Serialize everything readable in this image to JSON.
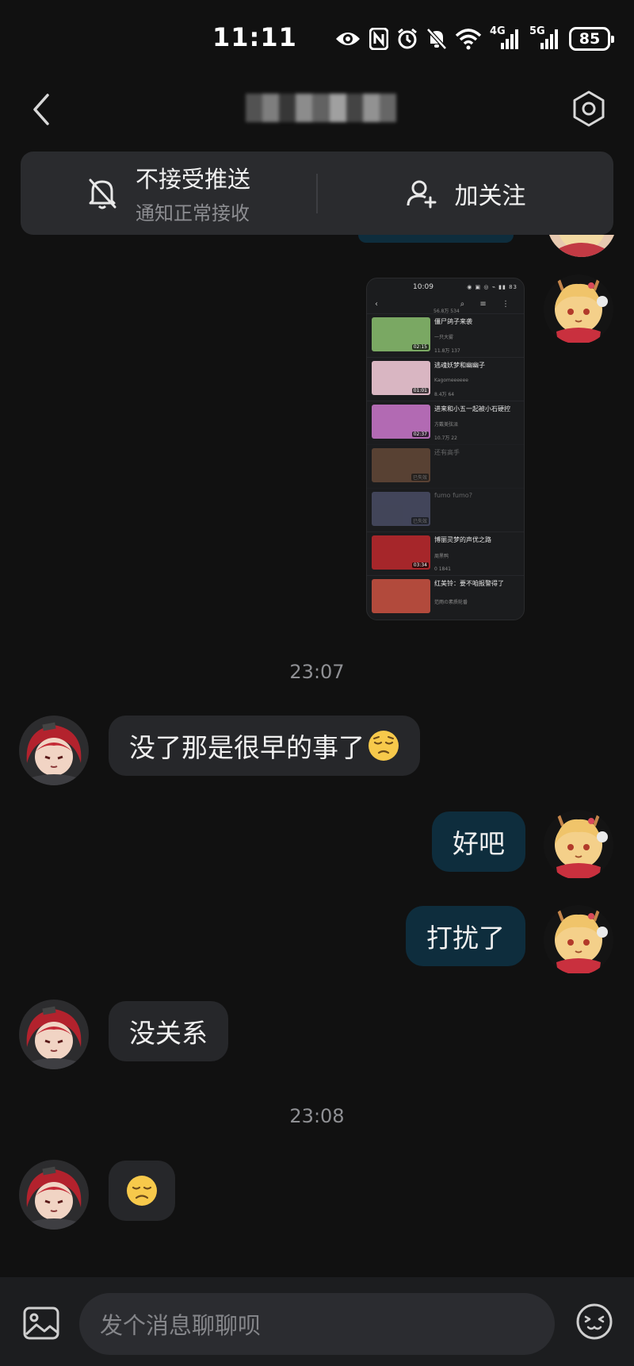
{
  "status_bar": {
    "time": "11:11",
    "icons": [
      "eye-icon",
      "nfc-icon",
      "alarm-icon",
      "mute-icon",
      "wifi-icon",
      "signal-4g-icon",
      "signal-5g-icon"
    ],
    "net1": "4G",
    "net2": "5G",
    "battery": "85"
  },
  "header": {
    "title_redacted": true,
    "back_icon": "chevron-left-icon",
    "settings_icon": "settings-hex-icon"
  },
  "notify_bar": {
    "mute_title": "不接受推送",
    "mute_subtitle": "通知正常接收",
    "follow_label": "加关注"
  },
  "shared_screenshot": {
    "time": "10:09",
    "top_stats": "56.8万  534",
    "videos": [
      {
        "title": "僵尸鸽子来袭",
        "author": "一只大雾",
        "stats": "11.8万  137",
        "duration": "02:15",
        "color": "#7aa863",
        "dim": false
      },
      {
        "title": "逃魂妖梦和幽幽子",
        "author": "Kagomeeeeee",
        "stats": "8.4万  64",
        "duration": "01:01",
        "color": "#d9b6c2",
        "dim": false
      },
      {
        "title": "进来和小五一起被小石硬控",
        "author": "方戴美弦派",
        "stats": "10.7万  22",
        "duration": "02:37",
        "color": "#b26ab3",
        "dim": false
      },
      {
        "title": "还有高手",
        "author": "",
        "stats": "",
        "duration": "已失效",
        "color": "#c9875b",
        "dim": true
      },
      {
        "title": "fumo fumo?",
        "author": "",
        "stats": "",
        "duration": "已失效",
        "color": "#8b92c9",
        "dim": true
      },
      {
        "title": "博丽灵梦的声优之路",
        "author": "周黑鸭",
        "stats": "0  1841",
        "duration": "03:34",
        "color": "#a6262a",
        "dim": false
      },
      {
        "title": "红美铃：要不咱报警得了",
        "author": "范雨の素质轮番",
        "stats": "",
        "duration": "",
        "color": "#b24a3c",
        "dim": false
      }
    ]
  },
  "messages": [
    {
      "type": "timestamp",
      "text": "23:07"
    },
    {
      "type": "left",
      "text": "没了那是很早的事了",
      "emoji": "pensive-face-emoji"
    },
    {
      "type": "right",
      "text": "好吧"
    },
    {
      "type": "right",
      "text": "打扰了"
    },
    {
      "type": "left",
      "text": "没关系"
    },
    {
      "type": "timestamp",
      "text": "23:08"
    },
    {
      "type": "left-emoji",
      "emoji": "disappointed-face-emoji"
    }
  ],
  "input": {
    "placeholder": "发个消息聊聊呗",
    "image_icon": "image-icon",
    "emoji_icon": "emoji-face-icon"
  },
  "colors": {
    "background": "#111111",
    "bubble_left": "#26272a",
    "bubble_right": "#0e2d3d",
    "bar": "#2a2b2e"
  }
}
